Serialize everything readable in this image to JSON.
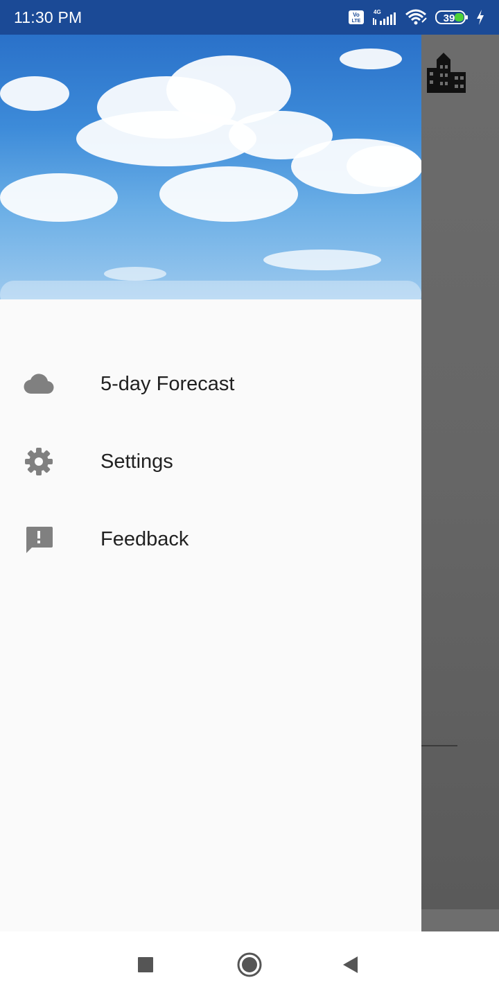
{
  "status_bar": {
    "time": "11:30 PM",
    "network_type": "4G",
    "volte_label": "Vo LTE",
    "battery_level": "39",
    "icons": [
      "volte-icon",
      "signal-icon",
      "wifi-icon",
      "battery-icon",
      "charging-icon"
    ]
  },
  "drawer": {
    "header_image": "sky-clouds",
    "items": [
      {
        "label": "5-day Forecast",
        "icon": "cloud-icon"
      },
      {
        "label": "Settings",
        "icon": "gear-icon"
      },
      {
        "label": "Feedback",
        "icon": "feedback-icon"
      }
    ]
  },
  "background_app": {
    "toolbar_icon": "city-icon"
  },
  "nav_bar": {
    "buttons": [
      "recents-button",
      "home-button",
      "back-button"
    ]
  },
  "colors": {
    "status_bar": "#1b4a96",
    "drawer_bg": "#fafafa",
    "icon_gray": "#808080",
    "text": "#212121",
    "scrim": "#6b6b6b"
  }
}
